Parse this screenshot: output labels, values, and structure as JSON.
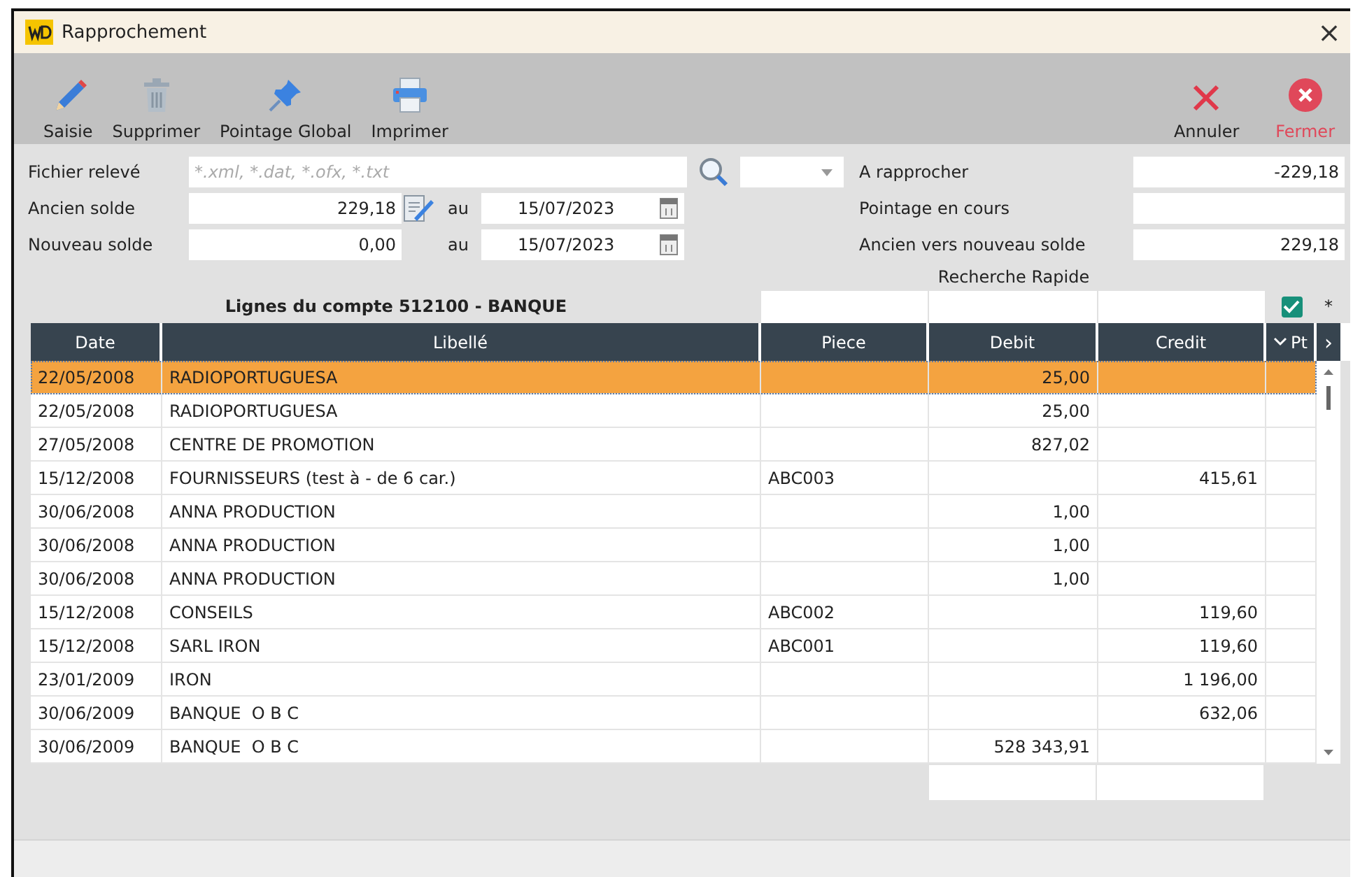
{
  "window": {
    "title": "Rapprochement",
    "close": "×"
  },
  "toolbar": {
    "left": [
      {
        "kind": "edit",
        "label": "Saisie"
      },
      {
        "kind": "delete",
        "label": "Supprimer"
      },
      {
        "kind": "pin",
        "label": "Pointage Global"
      },
      {
        "kind": "print",
        "label": "Imprimer"
      }
    ],
    "right": [
      {
        "kind": "cancel",
        "label": "Annuler"
      },
      {
        "kind": "close",
        "label": "Fermer"
      }
    ]
  },
  "form": {
    "file": {
      "label": "Fichier relevé",
      "placeholder": "*.xml, *.dat, *.ofx, *.txt"
    },
    "old_balance": {
      "label": "Ancien solde",
      "value": "229,18",
      "date_label": "au",
      "date": "15/07/2023"
    },
    "new_balance": {
      "label": "Nouveau solde",
      "value": "0,00",
      "date_label": "au",
      "date": "15/07/2023"
    },
    "summary": [
      {
        "label": "A rapprocher",
        "value": "-229,18"
      },
      {
        "label": "Pointage en cours"
      },
      {
        "label": "Ancien vers nouveau solde",
        "value": "229,18"
      }
    ]
  },
  "table": {
    "title": "Lignes du compte 512100 - BANQUE",
    "quick_search": "Recherche Rapide",
    "pointed_filter": {
      "checked": true
    },
    "marker": "*",
    "columns": [
      {
        "label": "Date",
        "kind": "text"
      },
      {
        "label": "Libellé",
        "kind": "text"
      },
      {
        "label": "Piece",
        "kind": "text"
      },
      {
        "label": "Debit",
        "kind": "amount"
      },
      {
        "label": "Credit",
        "kind": "amount"
      },
      {
        "label": "Pt",
        "kind": "flag"
      }
    ],
    "next": "›",
    "rows": [
      {
        "selected": true,
        "cells": [
          "22/05/2008",
          "RADIOPORTUGUESA",
          "",
          "25,00",
          ""
        ]
      },
      {
        "selected": false,
        "cells": [
          "22/05/2008",
          "RADIOPORTUGUESA",
          "",
          "25,00",
          ""
        ]
      },
      {
        "selected": false,
        "cells": [
          "27/05/2008",
          "CENTRE DE PROMOTION",
          "",
          "827,02",
          ""
        ]
      },
      {
        "selected": false,
        "cells": [
          "15/12/2008",
          "FOURNISSEURS (test à - de 6 car.)",
          "ABC003",
          "",
          "415,61"
        ]
      },
      {
        "selected": false,
        "cells": [
          "30/06/2008",
          "ANNA PRODUCTION",
          "",
          "1,00",
          ""
        ]
      },
      {
        "selected": false,
        "cells": [
          "30/06/2008",
          "ANNA PRODUCTION",
          "",
          "1,00",
          ""
        ]
      },
      {
        "selected": false,
        "cells": [
          "30/06/2008",
          "ANNA PRODUCTION",
          "",
          "1,00",
          ""
        ]
      },
      {
        "selected": false,
        "cells": [
          "15/12/2008",
          "CONSEILS",
          "ABC002",
          "",
          "119,60"
        ]
      },
      {
        "selected": false,
        "cells": [
          "15/12/2008",
          "SARL IRON",
          "ABC001",
          "",
          "119,60"
        ]
      },
      {
        "selected": false,
        "cells": [
          "23/01/2009",
          "IRON",
          "",
          "",
          "1 196,00"
        ]
      },
      {
        "selected": false,
        "cells": [
          "30/06/2009",
          "BANQUE  O B C",
          "",
          "",
          "632,06"
        ]
      },
      {
        "selected": false,
        "cells": [
          "30/06/2009",
          "BANQUE  O B C",
          "",
          "528 343,91",
          ""
        ]
      }
    ]
  }
}
